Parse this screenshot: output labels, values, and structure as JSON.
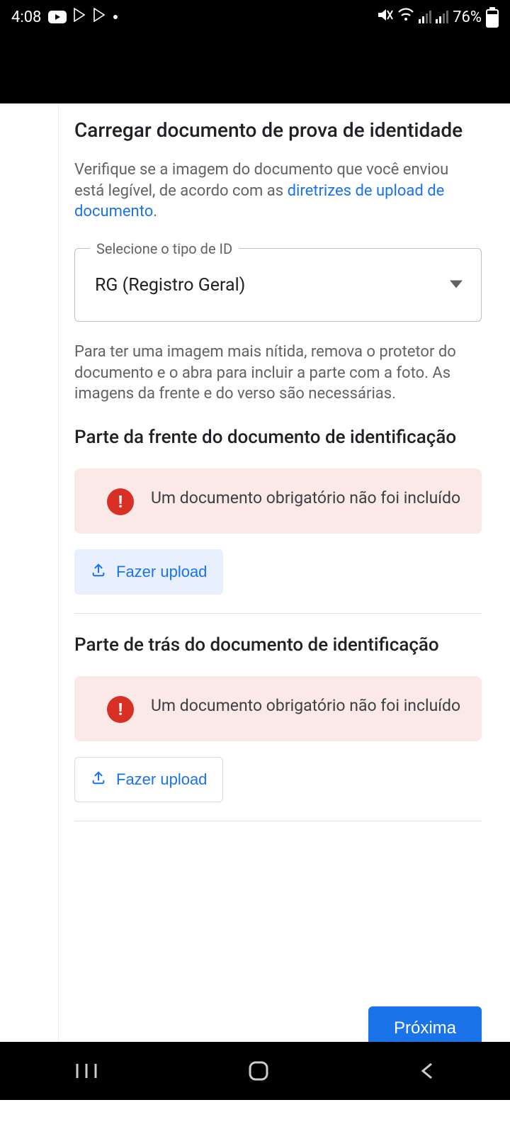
{
  "status": {
    "time": "4:08",
    "battery": "76%"
  },
  "page": {
    "title": "Carregar documento de prova de identidade",
    "desc_prefix": "Verifique se a imagem do documento que você enviou está legível, de acordo com as ",
    "desc_link": "diretrizes de upload de documento",
    "desc_suffix": ".",
    "select_label": "Selecione o tipo de ID",
    "select_value": "RG (Registro Geral)",
    "hint": "Para ter uma imagem mais nítida, remova o protetor do documento e o abra para incluir a parte com a foto. As imagens da frente e do verso são necessárias.",
    "front": {
      "heading": "Parte da frente do documento de identificação",
      "error": "Um documento obrigatório não foi incluído",
      "upload": "Fazer upload"
    },
    "back": {
      "heading": "Parte de trás do documento de identificação",
      "error": "Um documento obrigatório não foi incluído",
      "upload": "Fazer upload"
    },
    "next": "Próxima"
  }
}
